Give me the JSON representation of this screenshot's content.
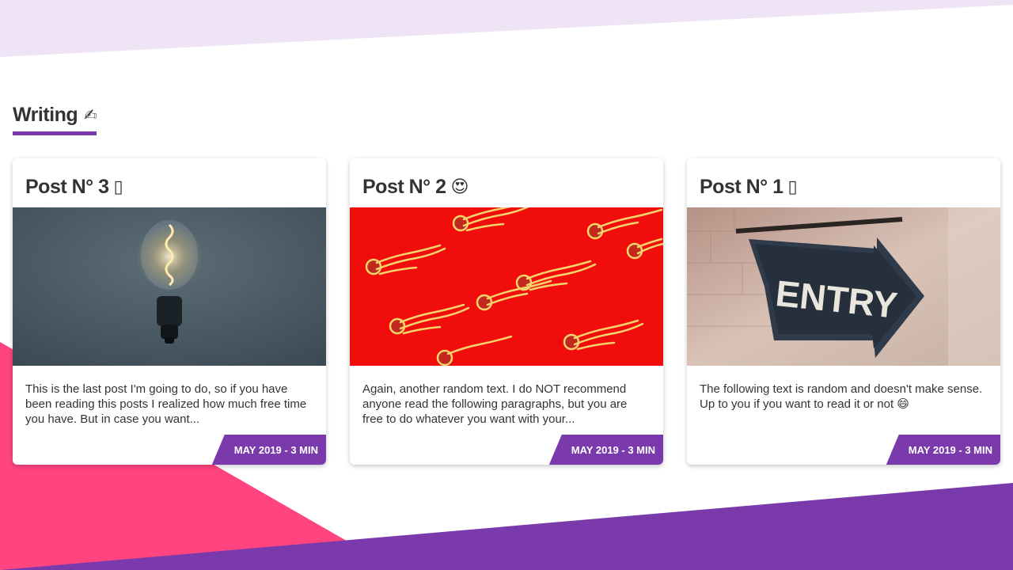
{
  "colors": {
    "accent": "#7b3aac",
    "pink": "#ff4480",
    "lavender": "#efe4f5",
    "text": "#333333"
  },
  "section": {
    "title": "Writing",
    "icon": "writing-hand-icon",
    "icon_glyph": "✍"
  },
  "posts": [
    {
      "title": "Post N° 3",
      "emoji": "▯",
      "image": "lightbulb-photo",
      "excerpt": "This is the last post I'm going to do, so if you have been reading this posts I realized how much free time you have. But in case you want...",
      "meta": "MAY 2019 - 3 MIN"
    },
    {
      "title": "Post N° 2",
      "emoji": "😍",
      "image": "noodles-pattern-photo",
      "excerpt": "Again, another random text. I do NOT recommend anyone read the following paragraphs, but you are free to do whatever you want with your...",
      "meta": "MAY 2019 - 3 MIN"
    },
    {
      "title": "Post N° 1",
      "emoji": "▯",
      "image": "entry-sign-photo",
      "excerpt": "The following text is random and doesn't make sense. Up to you if you want to read it or not 😄",
      "meta": "MAY 2019 - 3 MIN"
    }
  ]
}
